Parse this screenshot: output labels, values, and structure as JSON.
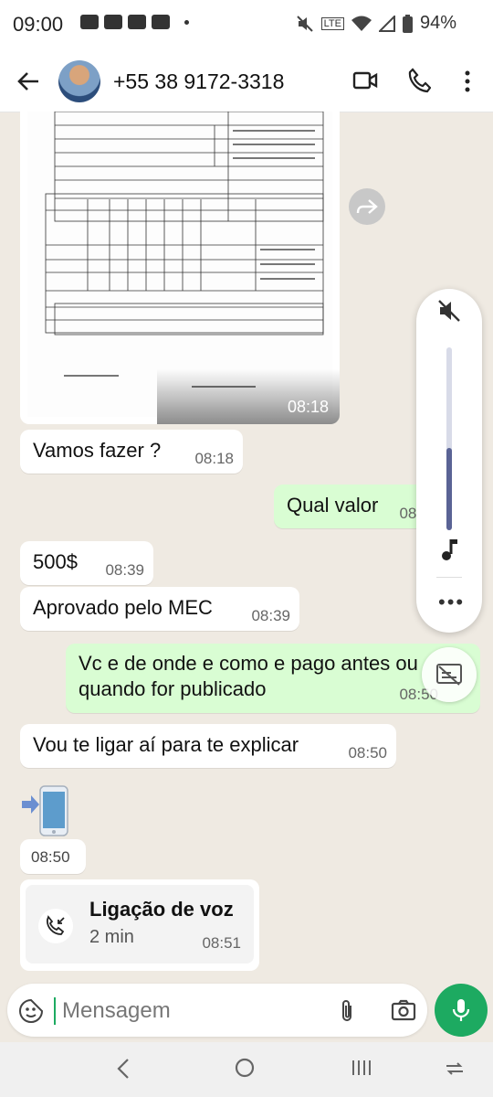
{
  "status_bar": {
    "time": "09:00",
    "battery": "94%",
    "volte": "LTE"
  },
  "header": {
    "contact": "+55 38 9172-3318"
  },
  "messages": [
    {
      "id": "doc",
      "time": "08:18"
    },
    {
      "id": "m1",
      "text": "Vamos fazer ?",
      "time": "08:18"
    },
    {
      "id": "m2",
      "text": "Qual valor",
      "time": "08:27"
    },
    {
      "id": "m3",
      "text": "500$",
      "time": "08:39"
    },
    {
      "id": "m4",
      "text": "Aprovado pelo MEC",
      "time": "08:39"
    },
    {
      "id": "m5",
      "text": "Vc e de onde e como e pago antes ou quando for publicado",
      "time": "08:50"
    },
    {
      "id": "m6",
      "text": "Vou te ligar aí para te explicar",
      "time": "08:50"
    },
    {
      "id": "m7",
      "time": "08:50"
    }
  ],
  "call": {
    "title": "Ligação de voz",
    "duration": "2 min",
    "time": "08:51"
  },
  "composer": {
    "placeholder": "Mensagem"
  },
  "volume": {
    "level": 0.45
  },
  "colors": {
    "accent": "#1daa61",
    "outgoing": "#d9fdd3",
    "chat_bg": "#efeae2"
  }
}
